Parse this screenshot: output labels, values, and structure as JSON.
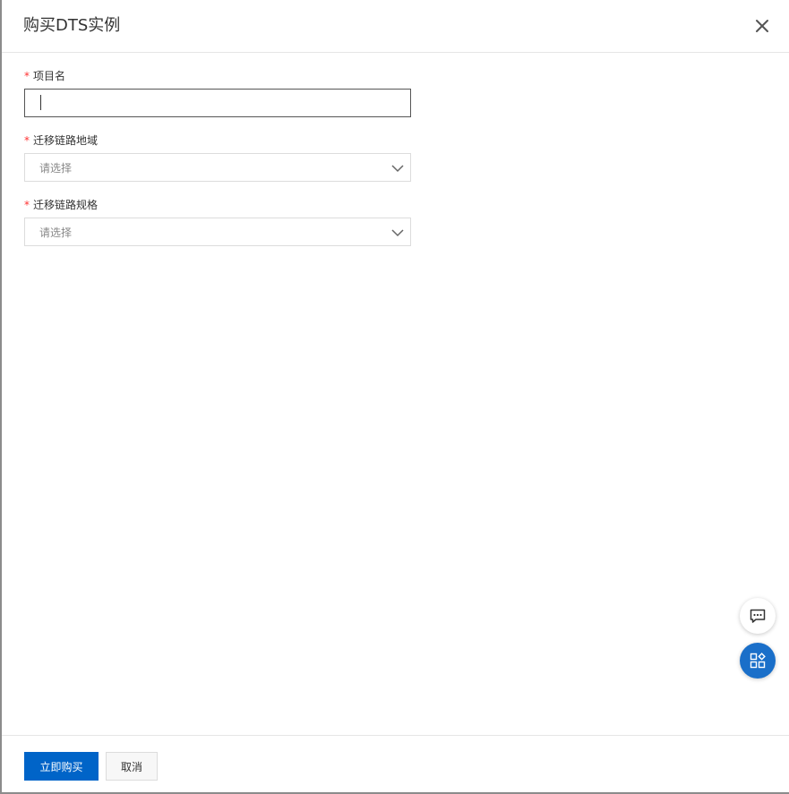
{
  "dialog": {
    "title": "购买DTS实例"
  },
  "form": {
    "required_mark": "*",
    "project_name": {
      "label": "项目名",
      "value": ""
    },
    "region": {
      "label": "迁移链路地域",
      "placeholder": "请选择"
    },
    "spec": {
      "label": "迁移链路规格",
      "placeholder": "请选择"
    }
  },
  "footer": {
    "buy_now_label": "立即购买",
    "cancel_label": "取消"
  },
  "icons": {
    "close": "close-icon",
    "select_arrow": "chevron-down-icon",
    "chat": "chat-bubble-icon",
    "apps": "apps-grid-icon"
  },
  "colors": {
    "primary": "#0064c8",
    "required": "#ff3333",
    "floating_active": "#1a6fc9"
  }
}
